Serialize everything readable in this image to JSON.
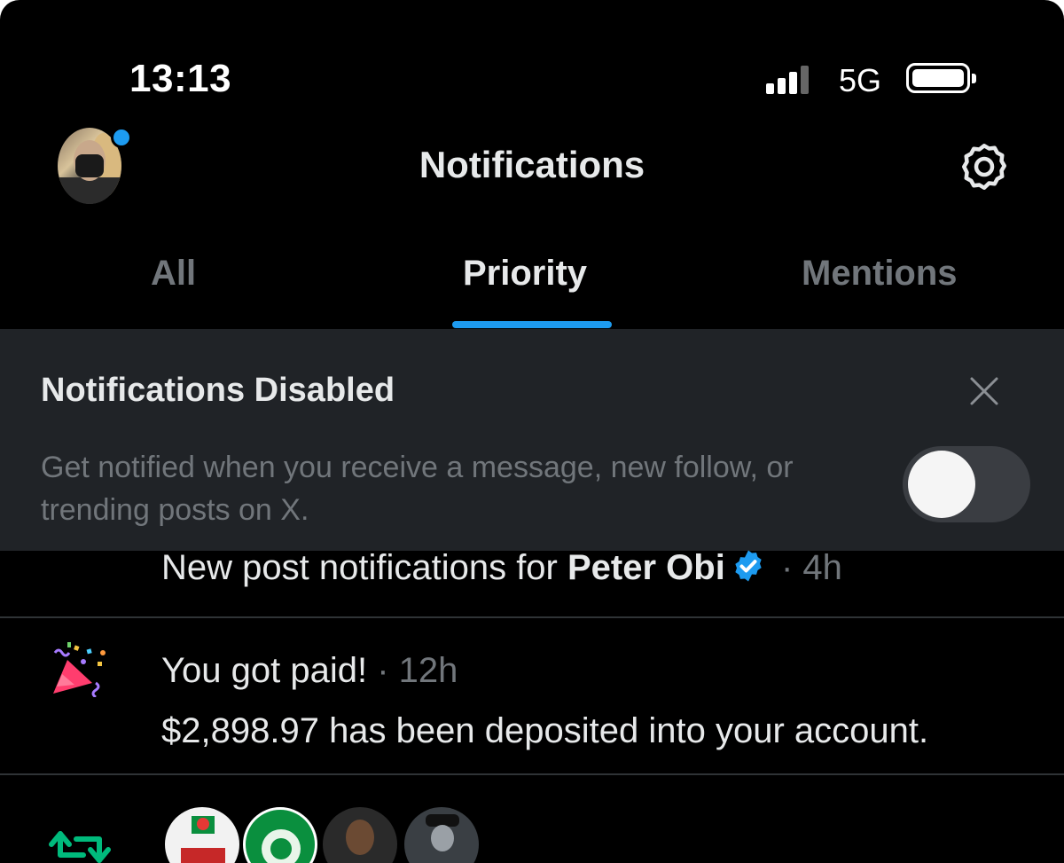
{
  "status_bar": {
    "time": "13:13",
    "network": "5G",
    "battery_level": 1.0
  },
  "header": {
    "title": "Notifications",
    "avatar_icon": "profile-avatar",
    "settings_icon": "gear-icon"
  },
  "tabs": [
    {
      "label": "All",
      "active": false
    },
    {
      "label": "Priority",
      "active": true
    },
    {
      "label": "Mentions",
      "active": false
    }
  ],
  "banner": {
    "title": "Notifications Disabled",
    "text": "Get notified when you receive a message, new follow, or trending posts on X.",
    "toggle_on": false
  },
  "notifications": [
    {
      "prefix": "New post notifications for ",
      "name": "Peter Obi",
      "time": " · 4h"
    },
    {
      "icon": "party-popper-icon",
      "title": "You got paid!",
      "time": " · 12h",
      "body": "$2,898.97 has been deposited into your account."
    },
    {
      "icon": "repost-icon"
    }
  ],
  "colors": {
    "accent": "#1d9bf0",
    "background": "#000000",
    "banner": "#202327",
    "muted": "#71767b"
  }
}
